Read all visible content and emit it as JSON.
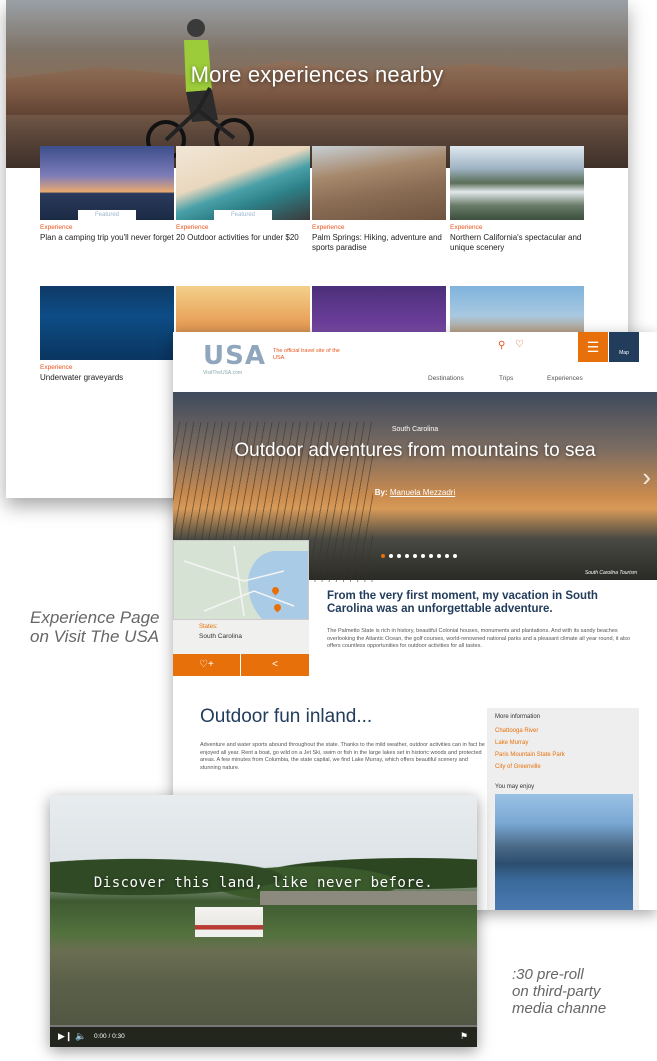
{
  "page1": {
    "title": "More experiences nearby",
    "cards": [
      {
        "category": "Experience",
        "title": "Plan a camping trip you'll never forget",
        "badge": "Featured"
      },
      {
        "category": "Experience",
        "title": "20 Outdoor activities for under $20",
        "badge": "Featured"
      },
      {
        "category": "Experience",
        "title": "Palm Springs: Hiking, adventure and sports paradise",
        "badge": ""
      },
      {
        "category": "Experience",
        "title": "Northern California's spectacular and unique scenery",
        "badge": ""
      },
      {
        "category": "Experience",
        "title": "Underwater graveyards",
        "badge": ""
      }
    ]
  },
  "page2": {
    "nav": {
      "logo": "USA",
      "logo_sub": "VisitTheUSA.com",
      "tagline": "The official travel site of the USA.",
      "links": [
        "Destinations",
        "Trips",
        "Experiences"
      ],
      "menu_icon": "menu-icon",
      "map_label": "Map"
    },
    "hero": {
      "state": "South Carolina",
      "title": "Outdoor adventures from mountains to sea",
      "by_prefix": "By:",
      "author": "Manuela Mezzadri",
      "credit": "South Carolina Tourism",
      "slides_total": 10,
      "slide_active": 1
    },
    "state_label": "States:",
    "state_value": "South Carolina",
    "lead": "From the very first moment, my vacation in South Carolina was an unforgettable adventure.",
    "body1": "The Palmetto State is rich in history, beautiful Colonial houses, monuments and plantations. And with its sandy beaches overlooking the Atlantic Ocean, the golf courses, world-renowned national parks and a pleasant climate all year round, it also offers countless opportunities for outdoor activities for all tastes.",
    "section_title": "Outdoor fun inland...",
    "body2": "Adventure and water sports abound throughout the state. Thanks to the mild weather, outdoor activities can in fact be enjoyed all year. Rent a boat, go wild on a Jet Ski, swim or fish in the large lakes set in historic woods and protected areas. A few minutes from Columbia, the state capital, we find Lake Murray, which offers beautiful scenery and stunning nature.",
    "sidebar": {
      "heading": "More information",
      "links": [
        "Chattooga River",
        "Lake Murray",
        "Paris Mountain State Park",
        "City of Greenville"
      ],
      "enjoy": "You may enjoy"
    }
  },
  "video": {
    "caption": "Discover this land, like never before.",
    "time": "0:00 / 0:30",
    "progress": 0
  },
  "captions": {
    "left": "Experience Page on Visit The USA",
    "right_line1": ":30 pre-roll",
    "right_line2": "on third-party",
    "right_line3": "media channe"
  },
  "colors": {
    "accent": "#e8700a",
    "navy": "#223c5c",
    "link": "#e8541c"
  }
}
